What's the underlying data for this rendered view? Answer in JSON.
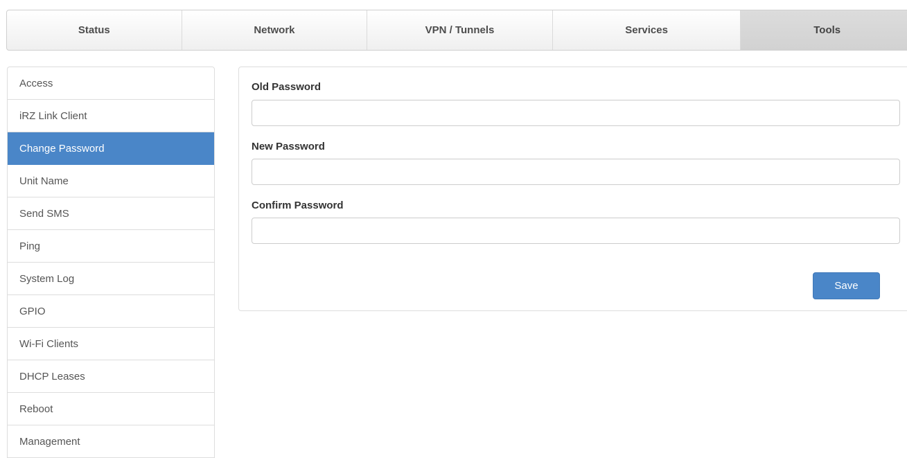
{
  "topnav": {
    "tabs": [
      {
        "label": "Status"
      },
      {
        "label": "Network"
      },
      {
        "label": "VPN / Tunnels"
      },
      {
        "label": "Services"
      },
      {
        "label": "Tools",
        "active": true
      }
    ]
  },
  "sidebar": {
    "items": [
      {
        "label": "Access"
      },
      {
        "label": "iRZ Link Client"
      },
      {
        "label": "Change Password",
        "active": true
      },
      {
        "label": "Unit Name"
      },
      {
        "label": "Send SMS"
      },
      {
        "label": "Ping"
      },
      {
        "label": "System Log"
      },
      {
        "label": "GPIO"
      },
      {
        "label": "Wi-Fi Clients"
      },
      {
        "label": "DHCP Leases"
      },
      {
        "label": "Reboot"
      },
      {
        "label": "Management"
      }
    ]
  },
  "form": {
    "old_password": {
      "label": "Old Password",
      "value": ""
    },
    "new_password": {
      "label": "New Password",
      "value": ""
    },
    "confirm_password": {
      "label": "Confirm Password",
      "value": ""
    },
    "save_label": "Save"
  },
  "colors": {
    "accent": "#4a86c8",
    "active_tab_bg": "#d6d6d6"
  }
}
